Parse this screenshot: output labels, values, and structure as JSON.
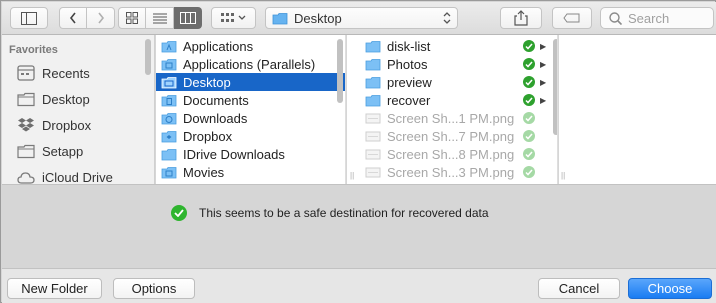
{
  "toolbar": {
    "path_label": "Desktop",
    "search_placeholder": "Search"
  },
  "sidebar": {
    "heading": "Favorites",
    "items": [
      {
        "label": "Recents",
        "icon": "clock-icon"
      },
      {
        "label": "Desktop",
        "icon": "folder-icon"
      },
      {
        "label": "Dropbox",
        "icon": "dropbox-icon"
      },
      {
        "label": "Setapp",
        "icon": "folder-icon"
      },
      {
        "label": "iCloud Drive",
        "icon": "cloud-icon"
      }
    ]
  },
  "column1": {
    "items": [
      {
        "label": "Applications"
      },
      {
        "label": "Applications (Parallels)"
      },
      {
        "label": "Desktop",
        "selected": true
      },
      {
        "label": "Documents"
      },
      {
        "label": "Downloads"
      },
      {
        "label": "Dropbox"
      },
      {
        "label": "IDrive Downloads"
      },
      {
        "label": "Movies"
      }
    ]
  },
  "column2": {
    "items": [
      {
        "label": "disk-list",
        "type": "folder"
      },
      {
        "label": "Photos",
        "type": "folder"
      },
      {
        "label": "preview",
        "type": "folder"
      },
      {
        "label": "recover",
        "type": "folder"
      },
      {
        "label": "Screen Sh...1 PM.png",
        "type": "file"
      },
      {
        "label": "Screen Sh...7 PM.png",
        "type": "file"
      },
      {
        "label": "Screen Sh...8 PM.png",
        "type": "file"
      },
      {
        "label": "Screen Sh...3 PM.png",
        "type": "file"
      }
    ]
  },
  "message": {
    "text": "This seems to be a safe destination for recovered data"
  },
  "buttons": {
    "new_folder": "New Folder",
    "options": "Options",
    "cancel": "Cancel",
    "choose": "Choose"
  },
  "colors": {
    "selection": "#1866c8",
    "primary_button": "#1a7cf2",
    "status_green": "#2ea12e"
  }
}
